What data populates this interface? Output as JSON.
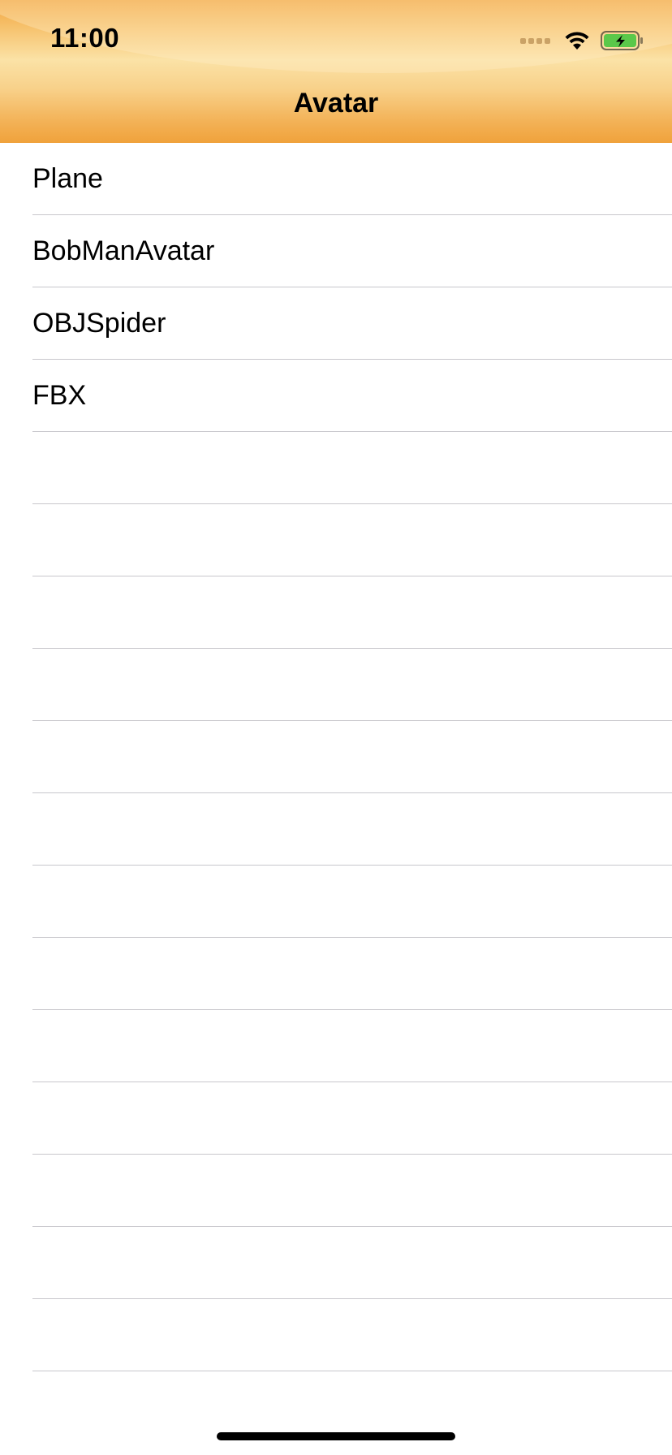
{
  "status_bar": {
    "time": "11:00",
    "icons": [
      "cellular-dots-icon",
      "wifi-icon",
      "battery-charging-icon"
    ]
  },
  "nav": {
    "title": "Avatar"
  },
  "list": {
    "items": [
      {
        "label": "Plane"
      },
      {
        "label": "BobManAvatar"
      },
      {
        "label": "OBJSpider"
      },
      {
        "label": "FBX"
      },
      {
        "label": ""
      },
      {
        "label": ""
      },
      {
        "label": ""
      },
      {
        "label": ""
      },
      {
        "label": ""
      },
      {
        "label": ""
      },
      {
        "label": ""
      },
      {
        "label": ""
      },
      {
        "label": ""
      },
      {
        "label": ""
      },
      {
        "label": ""
      },
      {
        "label": ""
      },
      {
        "label": ""
      }
    ]
  },
  "colors": {
    "nav_gradient_top": "#f2a43d",
    "nav_gradient_mid": "#fbe2a6",
    "separator": "#c8c7cc",
    "battery_fill": "#5ac84a"
  }
}
